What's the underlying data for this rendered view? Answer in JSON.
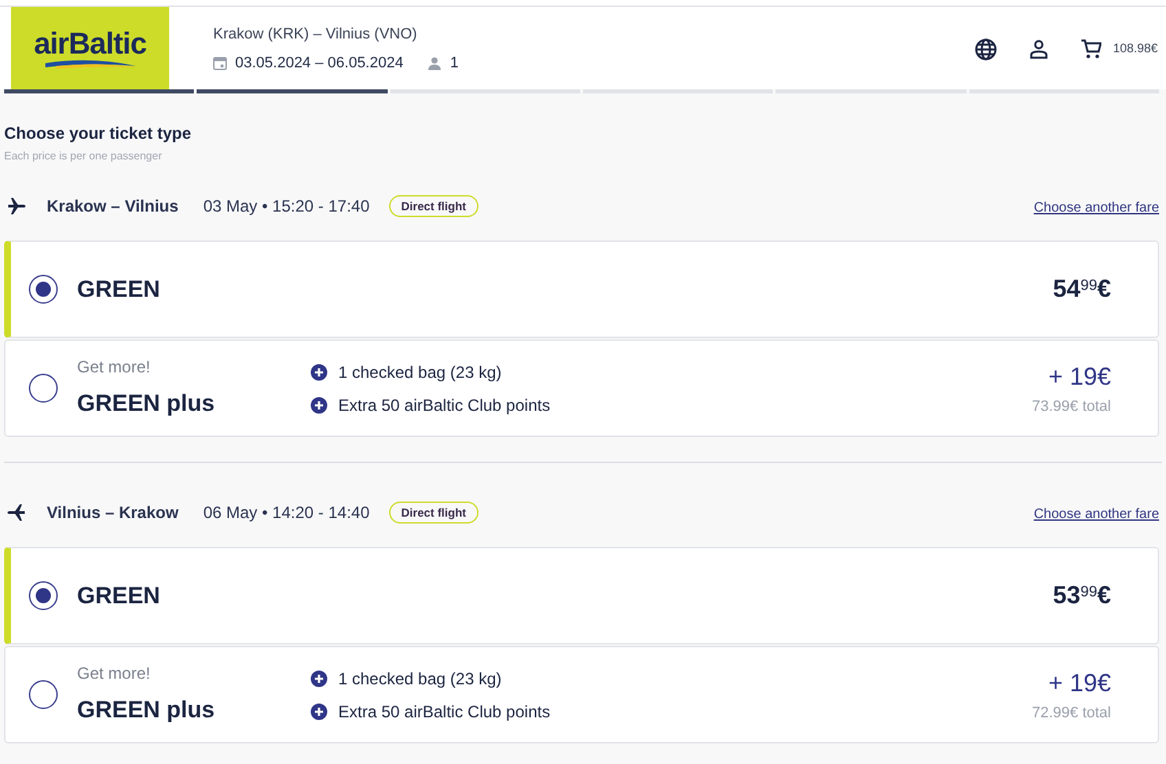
{
  "header": {
    "logo": "airBaltic",
    "route": "Krakow (KRK) – Vilnius (VNO)",
    "dates": "03.05.2024 – 06.05.2024",
    "passengers": "1",
    "cart_total": "108.98€"
  },
  "steps": [
    {
      "done": true
    },
    {
      "done": true
    },
    {
      "done": false
    },
    {
      "done": false
    },
    {
      "done": false
    },
    {
      "done": false
    }
  ],
  "heading": "Choose your ticket type",
  "subheading": "Each price is per one passenger",
  "flights": [
    {
      "kind": "outbound",
      "route": "Krakow – Vilnius",
      "time": "03 May • 15:20 - 17:40",
      "badge": "Direct flight",
      "link": "Choose another fare",
      "fares": [
        {
          "selected": true,
          "name": "GREEN",
          "price": "54$^{99}$€"
        },
        {
          "selected": false,
          "tagline": "Get more!",
          "name": "GREEN plus",
          "perks": [
            "1 checked bag (23 kg)",
            "Extra 50 airBaltic Club points"
          ],
          "price": "+ 19€",
          "total": "73.99€ total"
        }
      ]
    },
    {
      "kind": "return",
      "route": "Vilnius – Krakow",
      "time": "06 May • 14:20 - 14:40",
      "badge": "Direct flight",
      "link": "Choose another fare",
      "fares": [
        {
          "selected": true,
          "name": "GREEN",
          "price": "53$^{99}$€"
        },
        {
          "selected": false,
          "tagline": "Get more!",
          "name": "GREEN plus",
          "perks": [
            "1 checked bag (23 kg)",
            "Extra 50 airBaltic Club points"
          ],
          "price": "+ 19€",
          "total": "72.99€ total"
        }
      ]
    }
  ]
}
